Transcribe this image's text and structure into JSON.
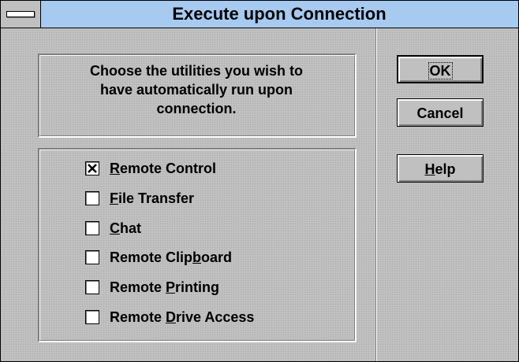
{
  "window": {
    "title": "Execute upon Connection"
  },
  "instructions": {
    "text_line1": "Choose the utilities you wish to",
    "text_line2": "have automatically run upon",
    "text_line3": "connection."
  },
  "options": [
    {
      "label_pre": "",
      "label_key": "R",
      "label_post": "emote Control",
      "checked": true
    },
    {
      "label_pre": "",
      "label_key": "F",
      "label_post": "ile Transfer",
      "checked": false
    },
    {
      "label_pre": "",
      "label_key": "C",
      "label_post": "hat",
      "checked": false
    },
    {
      "label_pre": "Remote Clip",
      "label_key": "b",
      "label_post": "oard",
      "checked": false
    },
    {
      "label_pre": "Remote ",
      "label_key": "P",
      "label_post": "rinting",
      "checked": false
    },
    {
      "label_pre": "Remote ",
      "label_key": "D",
      "label_post": "rive Access",
      "checked": false
    }
  ],
  "buttons": {
    "ok_label": "OK",
    "cancel_label": "Cancel",
    "help_key": "H",
    "help_rest": "elp"
  },
  "colors": {
    "titlebar": "#a6caf0",
    "face": "#c0c0c0",
    "shadow": "#808080",
    "highlight": "#ffffff"
  }
}
